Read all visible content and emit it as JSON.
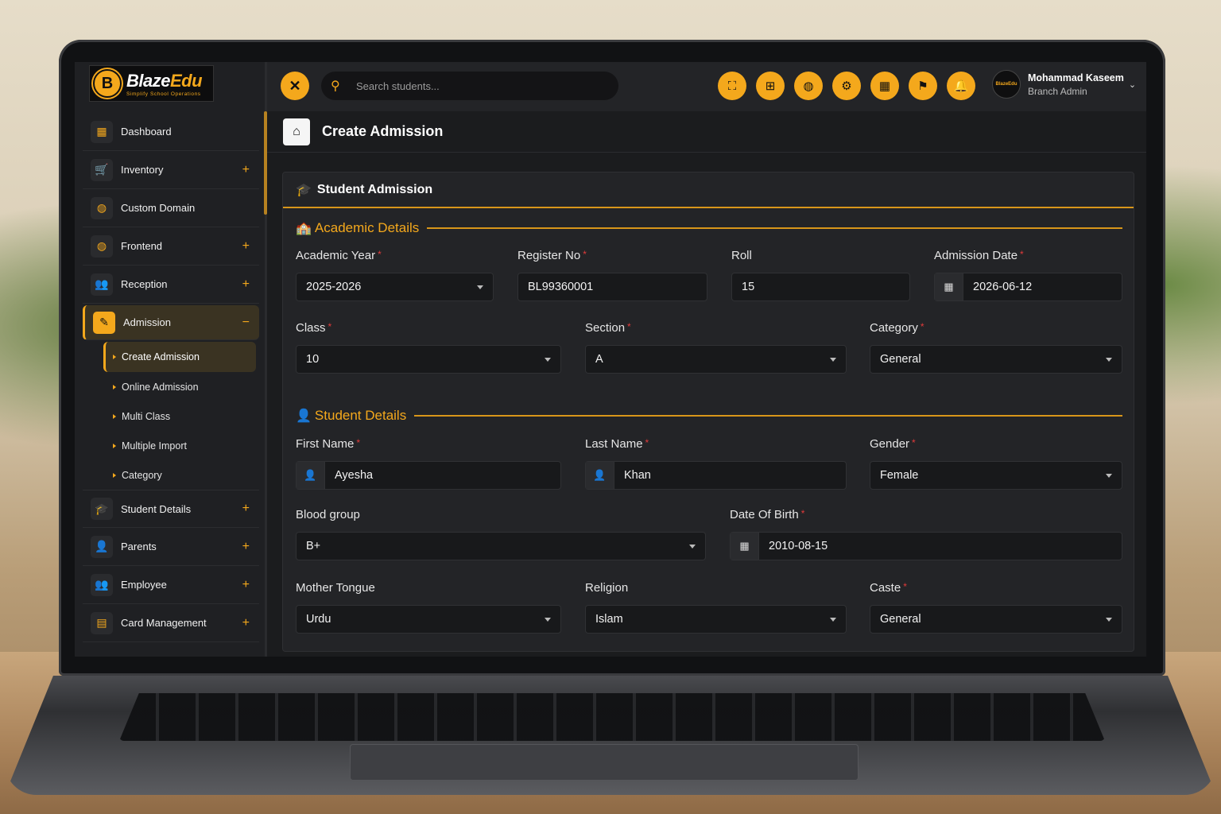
{
  "brand": {
    "name_a": "Blaze",
    "name_b": "Edu",
    "tagline": "Simplify School Operations",
    "badge": "B"
  },
  "search": {
    "placeholder": "Search students..."
  },
  "user": {
    "name": "Mohammad Kaseem",
    "role": "Branch Admin",
    "avatar_text": "BlazeEdu"
  },
  "sidebar": {
    "items": [
      {
        "label": "Dashboard",
        "icon": "grid-icon"
      },
      {
        "label": "Inventory",
        "icon": "cart-icon"
      },
      {
        "label": "Custom Domain",
        "icon": "globe-icon"
      },
      {
        "label": "Frontend",
        "icon": "globe-icon"
      },
      {
        "label": "Reception",
        "icon": "users-icon"
      },
      {
        "label": "Admission",
        "icon": "edit-icon"
      },
      {
        "label": "Student Details",
        "icon": "graduation-cap-icon"
      },
      {
        "label": "Parents",
        "icon": "user-icon"
      },
      {
        "label": "Employee",
        "icon": "users-icon"
      },
      {
        "label": "Card Management",
        "icon": "id-card-icon"
      }
    ],
    "admission_sub": [
      "Create Admission",
      "Online Admission",
      "Multi Class",
      "Multiple Import",
      "Category"
    ]
  },
  "page": {
    "title": "Create Admission"
  },
  "card": {
    "title": "Student Admission"
  },
  "sections": {
    "academic": "Academic Details",
    "student": "Student Details"
  },
  "fields": {
    "academic_year": {
      "label": "Academic Year",
      "value": "2025-2026"
    },
    "register_no": {
      "label": "Register No",
      "value": "BL99360001"
    },
    "roll": {
      "label": "Roll",
      "value": "15"
    },
    "admission_date": {
      "label": "Admission Date",
      "value": "2026-06-12"
    },
    "class": {
      "label": "Class",
      "value": "10"
    },
    "section": {
      "label": "Section",
      "value": "A"
    },
    "category": {
      "label": "Category",
      "value": "General"
    },
    "first_name": {
      "label": "First Name",
      "value": "Ayesha"
    },
    "last_name": {
      "label": "Last Name",
      "value": "Khan"
    },
    "gender": {
      "label": "Gender",
      "value": "Female"
    },
    "blood_group": {
      "label": "Blood group",
      "value": "B+"
    },
    "dob": {
      "label": "Date Of Birth",
      "value": "2010-08-15"
    },
    "mother_tongue": {
      "label": "Mother Tongue",
      "value": "Urdu"
    },
    "religion": {
      "label": "Religion",
      "value": "Islam"
    },
    "caste": {
      "label": "Caste",
      "value": "General"
    }
  },
  "required_mark": "*",
  "colors": {
    "accent": "#f4a81c",
    "required": "#e23b3b",
    "panel": "#232427"
  }
}
